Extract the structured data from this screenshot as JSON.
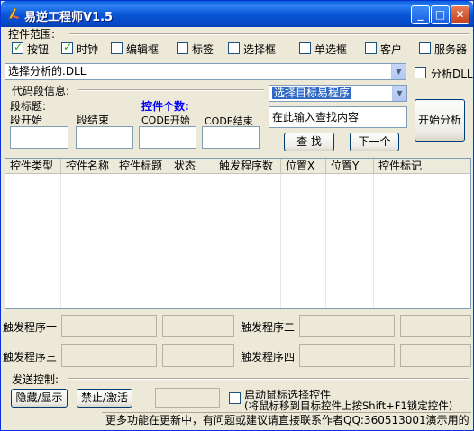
{
  "window": {
    "title": "易逆工程师V1.5"
  },
  "scope": {
    "label": "控件范围:",
    "checkboxes": [
      {
        "label": "按钮",
        "checked": true
      },
      {
        "label": "时钟",
        "checked": true
      },
      {
        "label": "编辑框",
        "checked": false
      },
      {
        "label": "标签",
        "checked": false
      },
      {
        "label": "选择框",
        "checked": false
      },
      {
        "label": "单选框",
        "checked": false
      },
      {
        "label": "客户",
        "checked": false
      },
      {
        "label": "服务器",
        "checked": false
      }
    ]
  },
  "dll": {
    "value": "选择分析的.DLL",
    "analyze_dll_label": "分析DLL"
  },
  "code_info": {
    "label": "代码段信息:",
    "segment_title_label": "段标题:",
    "segment_start_label": "段开始",
    "segment_end_label": "段结束",
    "control_count_label": "控件个数:",
    "code_start_label": "CODE开始",
    "code_end_label": "CODE结束"
  },
  "target": {
    "combo_value": "选择目标易程序",
    "search_placeholder": "在此输入查找内容",
    "search_button": "查 找",
    "next_button": "下一个",
    "start_button": "开始分析"
  },
  "table": {
    "columns": [
      "控件类型",
      "控件名称",
      "控件标题",
      "状态",
      "触发程序数",
      "位置X",
      "位置Y",
      "控件标记"
    ]
  },
  "triggers": {
    "t1": "触发程序一",
    "t2": "触发程序二",
    "t3": "触发程序三",
    "t4": "触发程序四"
  },
  "send": {
    "label": "发送控制:",
    "hide_show_button": "隐藏/显示",
    "disable_enable_button": "禁止/激活",
    "mouse_select_label": "启动鼠标选择控件",
    "hint": "(将鼠标移到目标控件上按Shift+F1锁定控件)"
  },
  "status": {
    "text": "更多功能在更新中，有问题或建议请直接联系作者QQ:360513001演示用的"
  }
}
